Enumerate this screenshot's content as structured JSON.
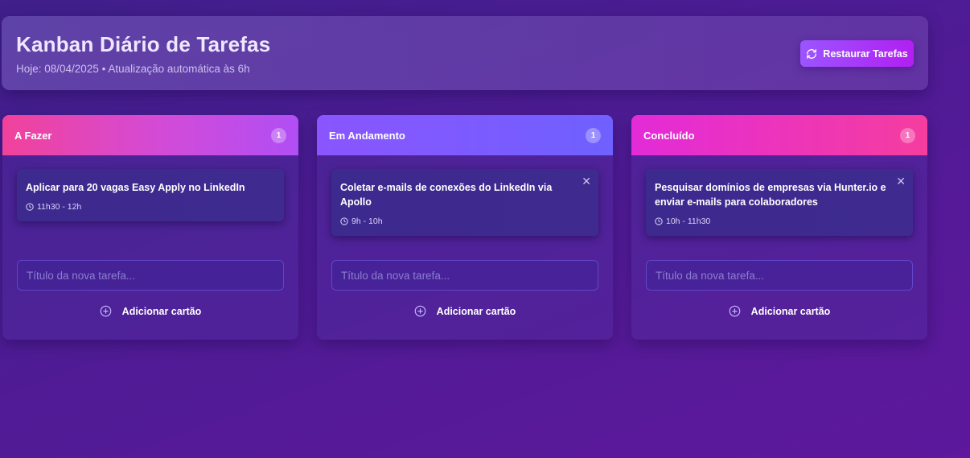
{
  "header": {
    "title": "Kanban Diário de Tarefas",
    "subtitle": "Hoje: 08/04/2025 • Atualização automática às 6h",
    "restore_label": "Restaurar Tarefas",
    "restore_icon": "refresh-icon"
  },
  "columns": [
    {
      "title": "A Fazer",
      "count": "1",
      "card": {
        "title": "Aplicar para 20 vagas Easy Apply no LinkedIn",
        "time": "11h30 - 12h"
      },
      "input_placeholder": "Título da nova tarefa...",
      "add_label": "Adicionar cartão"
    },
    {
      "title": "Em Andamento",
      "count": "1",
      "card": {
        "title": "Coletar e-mails de conexões do LinkedIn via Apollo",
        "time": "9h - 10h"
      },
      "input_placeholder": "Título da nova tarefa...",
      "add_label": "Adicionar cartão"
    },
    {
      "title": "Concluído",
      "count": "1",
      "card": {
        "title": "Pesquisar domínios de empresas via Hunter.io e enviar e-mails para colaboradores",
        "time": "10h - 11h30"
      },
      "input_placeholder": "Título da nova tarefa...",
      "add_label": "Adicionar cartão"
    }
  ],
  "colors": {
    "accent": "#9b55ff",
    "todo_header": "#f1429b",
    "doing_header": "#7a5cff",
    "done_header": "#e32bd8"
  }
}
